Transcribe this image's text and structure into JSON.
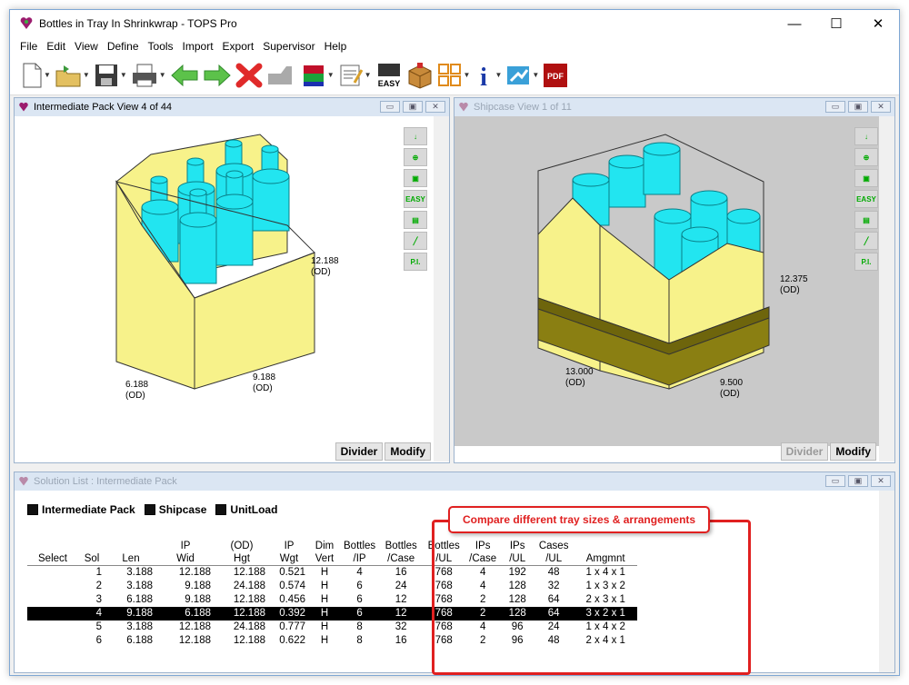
{
  "window": {
    "title": "Bottles in Tray In Shrinkwrap - TOPS Pro",
    "minimize": "—",
    "maximize": "☐",
    "close": "✕"
  },
  "menu": [
    "File",
    "Edit",
    "View",
    "Define",
    "Tools",
    "Import",
    "Export",
    "Supervisor",
    "Help"
  ],
  "toolbar": {
    "icons": [
      "new-icon",
      "open-icon",
      "save-icon",
      "print-icon",
      "back-arrow-icon",
      "forward-arrow-icon",
      "delete-icon",
      "disabled-tool-icon",
      "stack-icon",
      "notes-icon",
      "easy-icon",
      "box-icon",
      "layout-icon",
      "info-icon",
      "export-icon",
      "pdf-icon"
    ],
    "easy_label": "EASY",
    "pdf_label": "PDF",
    "info_label": "i"
  },
  "ip_view": {
    "title": "Intermediate Pack View  4 of 44",
    "dims": {
      "height": "12.188",
      "height_unit": "(OD)",
      "length": "6.188",
      "length_unit": "(OD)",
      "width": "9.188",
      "width_unit": "(OD)"
    },
    "tools": [
      "↓",
      "⊕",
      "▣",
      "EASY",
      "▤",
      "╱",
      "P.I."
    ],
    "buttons": {
      "divider": "Divider",
      "modify": "Modify"
    }
  },
  "sc_view": {
    "title": "Shipcase View  1 of 11",
    "dims": {
      "height": "12.375",
      "height_unit": "(OD)",
      "length": "13.000",
      "length_unit": "(OD)",
      "width": "9.500",
      "width_unit": "(OD)"
    },
    "tools": [
      "↓",
      "⊕",
      "▣",
      "EASY",
      "▤",
      "╱",
      "P.I."
    ],
    "buttons": {
      "divider": "Divider",
      "modify": "Modify"
    }
  },
  "solution": {
    "title": "Solution List : Intermediate Pack",
    "tabs": [
      "Intermediate Pack",
      "Shipcase",
      "UnitLoad"
    ],
    "callout": "Compare different tray sizes & arrangements",
    "headers": [
      [
        "",
        "Select"
      ],
      [
        "",
        "Sol"
      ],
      [
        "",
        "Len"
      ],
      [
        "IP",
        "Wid"
      ],
      [
        "(OD)",
        "Hgt"
      ],
      [
        "IP",
        "Wgt"
      ],
      [
        "Dim",
        "Vert"
      ],
      [
        "Bottles",
        "/IP"
      ],
      [
        "Bottles",
        "/Case"
      ],
      [
        "Bottles",
        "/UL"
      ],
      [
        "IPs",
        "/Case"
      ],
      [
        "IPs",
        "/UL"
      ],
      [
        "Cases",
        "/UL"
      ],
      [
        "",
        "Amgmnt"
      ]
    ],
    "rows": [
      [
        "",
        "1",
        "3.188",
        "12.188",
        "12.188",
        "0.521",
        "H",
        "4",
        "16",
        "768",
        "4",
        "192",
        "48",
        "1 x 4 x 1"
      ],
      [
        "",
        "2",
        "3.188",
        "9.188",
        "24.188",
        "0.574",
        "H",
        "6",
        "24",
        "768",
        "4",
        "128",
        "32",
        "1 x 3 x 2"
      ],
      [
        "",
        "3",
        "6.188",
        "9.188",
        "12.188",
        "0.456",
        "H",
        "6",
        "12",
        "768",
        "2",
        "128",
        "64",
        "2 x 3 x 1"
      ],
      [
        "",
        "4",
        "9.188",
        "6.188",
        "12.188",
        "0.392",
        "H",
        "6",
        "12",
        "768",
        "2",
        "128",
        "64",
        "3 x 2 x 1"
      ],
      [
        "",
        "5",
        "3.188",
        "12.188",
        "24.188",
        "0.777",
        "H",
        "8",
        "32",
        "768",
        "4",
        "96",
        "24",
        "1 x 4 x 2"
      ],
      [
        "",
        "6",
        "6.188",
        "12.188",
        "12.188",
        "0.622",
        "H",
        "8",
        "16",
        "768",
        "2",
        "96",
        "48",
        "2 x 4 x 1"
      ]
    ],
    "selected_row": 3
  },
  "colors": {
    "bottle": "#22e5f0",
    "tray": "#f7f28a",
    "pallet": "#8a7f12",
    "callout": "#e02020",
    "viewport_bg": "#c9c9c9"
  }
}
